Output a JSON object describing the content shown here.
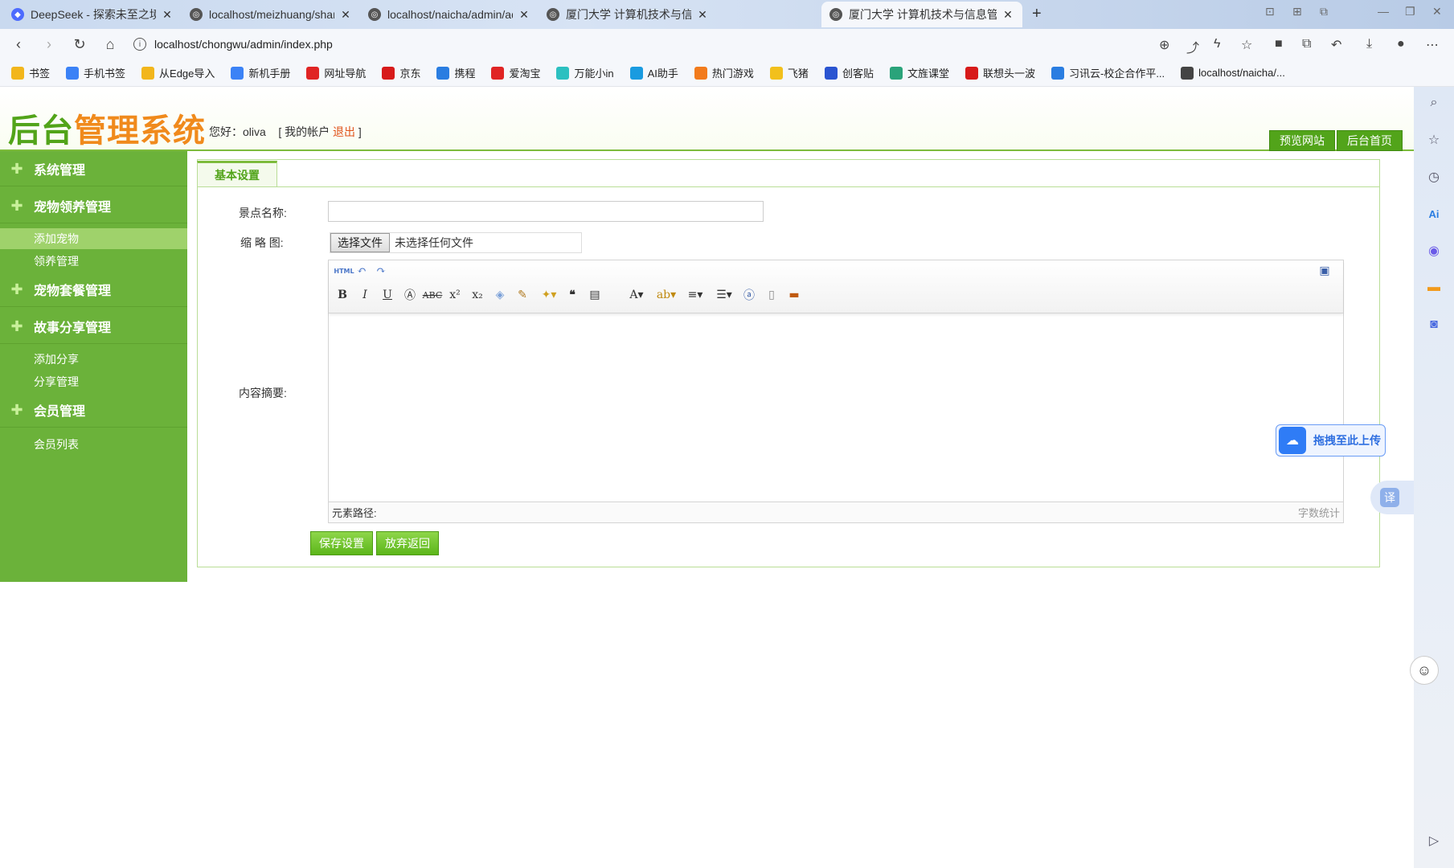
{
  "browser": {
    "tabs": [
      {
        "title": "DeepSeek - 探索未至之境",
        "favicon": "deepseek-icon"
      },
      {
        "title": "localhost/meizhuang/shangpin",
        "favicon": "globe-icon"
      },
      {
        "title": "localhost/naicha/admin/admin",
        "favicon": "globe-icon"
      },
      {
        "title": "厦门大学   计算机技术与信息管理",
        "favicon": "globe-icon"
      },
      {
        "title": "厦门大学   计算机技术与信息管理",
        "favicon": "globe-icon"
      }
    ],
    "url": "localhost/chongwu/admin/index.php",
    "bookmarks": [
      {
        "label": "书签",
        "color": "#f2b61c"
      },
      {
        "label": "手机书签",
        "color": "#3b82f6"
      },
      {
        "label": "从Edge导入",
        "color": "#f2b61c"
      },
      {
        "label": "新机手册",
        "color": "#3b82f6"
      },
      {
        "label": "网址导航",
        "color": "#e02424"
      },
      {
        "label": "京东",
        "color": "#d71a1a"
      },
      {
        "label": "携程",
        "color": "#2a7de1"
      },
      {
        "label": "爱淘宝",
        "color": "#e02424"
      },
      {
        "label": "万能小in",
        "color": "#2cc0c0"
      },
      {
        "label": "AI助手",
        "color": "#1a9be0"
      },
      {
        "label": "热门游戏",
        "color": "#f27b1c"
      },
      {
        "label": "飞猪",
        "color": "#f2c01c"
      },
      {
        "label": "创客贴",
        "color": "#2a54d1"
      },
      {
        "label": "文旌课堂",
        "color": "#2aa37a"
      },
      {
        "label": "联想头一波",
        "color": "#d71a1a"
      },
      {
        "label": "习讯云-校企合作平...",
        "color": "#2a7de1"
      },
      {
        "label": "localhost/naicha/...",
        "color": "#444444"
      }
    ]
  },
  "header": {
    "logo_green": "后台",
    "logo_orange": "管理系统",
    "greeting_prefix": "您好：",
    "username": "oliva",
    "account_open": "[ 我的帐户 ",
    "logout": "退出",
    "account_close": " ]",
    "preview_site": "预览网站",
    "admin_home": "后台首页"
  },
  "sidebar": {
    "sections": [
      {
        "label": "系统管理"
      },
      {
        "label": "宠物领养管理"
      },
      {
        "label": "宠物套餐管理"
      },
      {
        "label": "故事分享管理"
      },
      {
        "label": "会员管理"
      }
    ],
    "items": [
      {
        "label": "添加宠物"
      },
      {
        "label": "领养管理"
      },
      {
        "label": "添加分享"
      },
      {
        "label": "分享管理"
      },
      {
        "label": "会员列表"
      }
    ]
  },
  "form": {
    "tab_label": "基本设置",
    "name_label": "景点名称:",
    "name_value": "",
    "thumb_label": "缩 略 图:",
    "file_button": "选择文件",
    "file_status": "未选择任何文件",
    "summary_label": "内容摘要:",
    "editor_path_label": "元素路径:",
    "editor_wordcount": "字数统计",
    "save_button": "保存设置",
    "cancel_button": "放弃返回"
  },
  "floats": {
    "upload_label": "拖拽至此上传",
    "translate_label": "译"
  }
}
